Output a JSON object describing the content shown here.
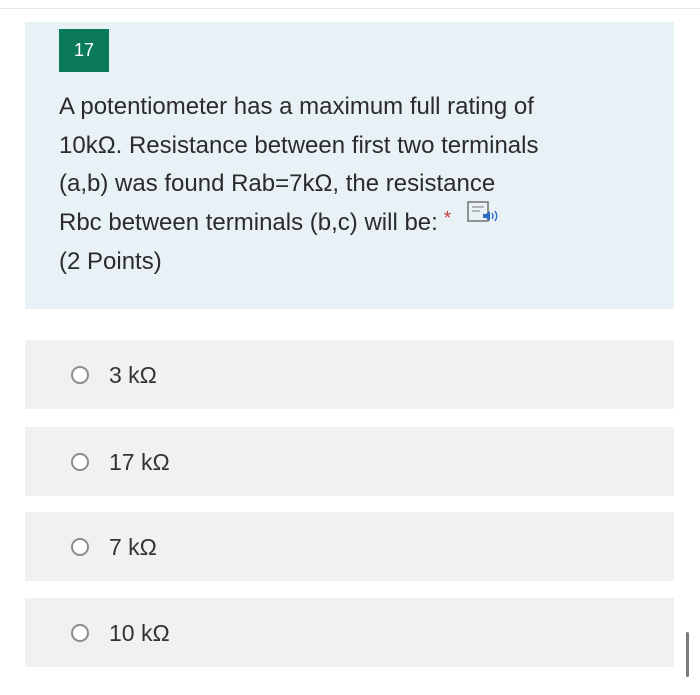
{
  "question": {
    "number": "17",
    "text_lines": [
      "A potentiometer has a maximum full rating of",
      "10kΩ. Resistance between first two terminals",
      "(a,b) was found Rab=7kΩ, the resistance",
      "Rbc between terminals (b,c) will be:"
    ],
    "required_mark": "*",
    "points": "(2 Points)",
    "icons": {
      "read_aloud": "immersive-reader-speaker-icon"
    }
  },
  "options": [
    {
      "label": "3 kΩ"
    },
    {
      "label": "17 kΩ"
    },
    {
      "label": "7 kΩ"
    },
    {
      "label": "10 kΩ"
    }
  ],
  "colors": {
    "number_badge": "#0b7a5a",
    "card_background": "#e8f1f5",
    "option_background": "#f1f1f1",
    "required": "#c0392b"
  }
}
